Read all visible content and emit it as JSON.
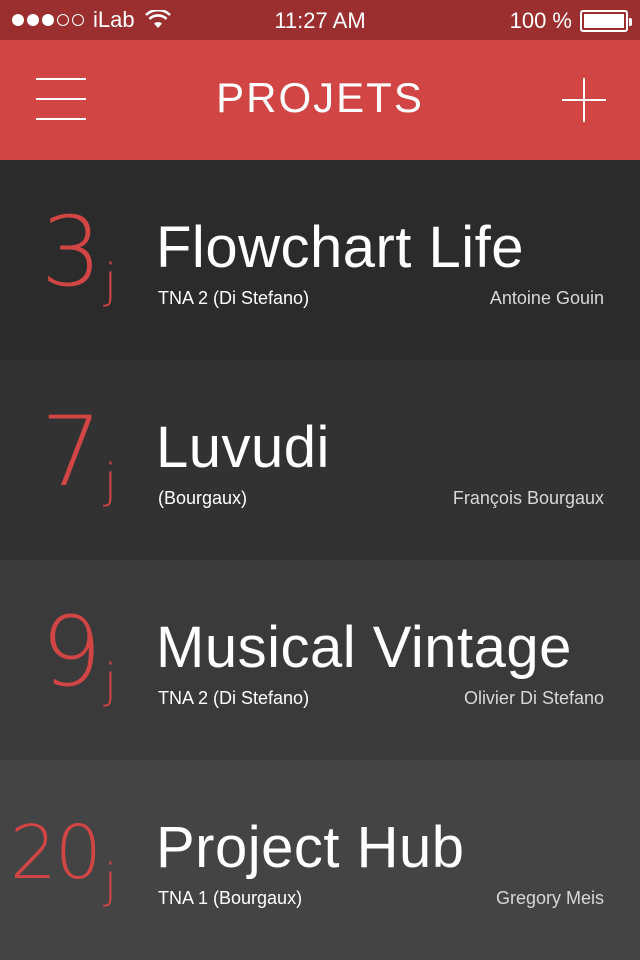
{
  "status_bar": {
    "carrier": "iLab",
    "time": "11:27 AM",
    "battery": "100 %",
    "signal_dots_filled": 3,
    "signal_dots_total": 5
  },
  "nav": {
    "title": "PROJETS",
    "menu_icon": "hamburger-menu-icon",
    "add_icon": "plus-icon"
  },
  "colors": {
    "accent": "#d24545",
    "status_bar": "#9b2f2f"
  },
  "projects": [
    {
      "days": "3",
      "unit": "j",
      "title": "Flowchart Life",
      "team": "TNA 2 (Di Stefano)",
      "owner": "Antoine Gouin",
      "bg": "#2b2b2b"
    },
    {
      "days": "7",
      "unit": "j",
      "title": "Luvudi",
      "team": "(Bourgaux)",
      "owner": "François Bourgaux",
      "bg": "#323232"
    },
    {
      "days": "9",
      "unit": "j",
      "title": "Musical Vintage",
      "team": "TNA 2 (Di Stefano)",
      "owner": "Olivier Di Stefano",
      "bg": "#3a3a3a"
    },
    {
      "days": "20",
      "unit": "j",
      "title": "Project Hub",
      "team": "TNA 1 (Bourgaux)",
      "owner": "Gregory Meis",
      "bg": "#444444"
    }
  ]
}
